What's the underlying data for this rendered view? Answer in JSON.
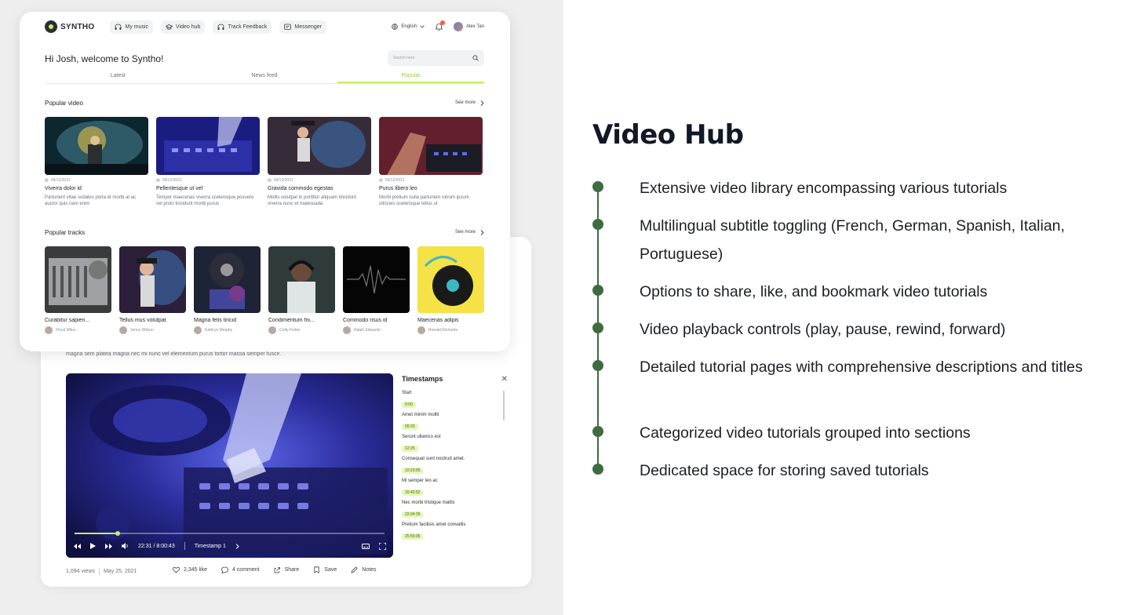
{
  "app": {
    "logo": "SYNTHO",
    "nav": [
      {
        "label": "My music",
        "icon": "headphones-icon"
      },
      {
        "label": "Video hub",
        "icon": "graduation-cap-icon"
      },
      {
        "label": "Track Feedback",
        "icon": "headphones-icon"
      },
      {
        "label": "Messenger",
        "icon": "message-icon"
      }
    ],
    "language": "English",
    "user_name": "Alex Tan",
    "welcome": "Hi Josh, welcome to Syntho!",
    "search_placeholder": "Search here",
    "tabs": [
      "Latest",
      "News feed",
      "Popular"
    ],
    "active_tab": "Popular",
    "popular_video": {
      "title": "Popular video",
      "see_more": "See more",
      "items": [
        {
          "date": "09/12/2021",
          "title": "Viverra dolor id",
          "desc": "Parturient vitae sodales porta et morbi at ac auctor quis nam enim"
        },
        {
          "date": "09/12/2021",
          "title": "Pellentesque ut vel",
          "desc": "Tempor maecenas viverra scelerisque posuere vel proin tincidunt morbi purus"
        },
        {
          "date": "09/12/2021",
          "title": "Gravida commodo egestas",
          "desc": "Mollis volutpat in porttitor aliquam tincidunt viverra nunc et malesuada"
        },
        {
          "date": "09/12/2021",
          "title": "Purus libero leo",
          "desc": "Morbi pretium nulla parturient rutrum ipsum ultricies scelerisque tellus ut"
        }
      ]
    },
    "popular_tracks": {
      "title": "Popular tracks",
      "see_more": "See more",
      "items": [
        {
          "title": "Curabitur sapien...",
          "artist": "Floyd Miles"
        },
        {
          "title": "Tellus mus volutpat",
          "artist": "Jenny Wilson"
        },
        {
          "title": "Magna felis tincid",
          "artist": "Kathryn Murphy"
        },
        {
          "title": "Condimentum frii...",
          "artist": "Cody Fisher"
        },
        {
          "title": "Commodo risus id",
          "artist": "Ralph Edwards"
        },
        {
          "title": "Maecenas adipis",
          "artist": "Ronald Richards"
        }
      ]
    }
  },
  "player": {
    "description": "magna sem platea magna nec mi nunc vel elementum purus tortor massa semper fusce.",
    "time": "22:31 / 8:00:43",
    "timestamp_label": "Timestamp 1",
    "progress": 0.14,
    "timestamps_title": "Timestamps",
    "timestamps": [
      {
        "label": "Start",
        "time": "0:00"
      },
      {
        "label": "Amet minim mollit",
        "time": "09:20"
      },
      {
        "label": "Serunt ullamco est",
        "time": "12:25"
      },
      {
        "label": "Consequat sunt nostrud amet.",
        "time": "10:23:05"
      },
      {
        "label": "Mi semper leo ac",
        "time": "15:43:52"
      },
      {
        "label": "Nec morbi tristique mattis",
        "time": "22:04:35"
      },
      {
        "label": "Pretium facilisis amet convallis",
        "time": "25:55:05"
      }
    ],
    "views": "1,094 views",
    "date": "May 25, 2021",
    "actions": [
      {
        "label": "2,345 like",
        "icon": "heart-icon"
      },
      {
        "label": "4 comment",
        "icon": "comment-icon"
      },
      {
        "label": "Share",
        "icon": "share-icon"
      },
      {
        "label": "Save",
        "icon": "bookmark-icon"
      },
      {
        "label": "Notes",
        "icon": "pencil-icon"
      }
    ]
  },
  "feature_panel": {
    "title": "Video Hub",
    "features": [
      "Extensive video library encompassing various tutorials",
      "Multilingual subtitle toggling (French, German, Spanish, Italian, Portuguese)",
      "Options to share, like, and bookmark video tutorials",
      "Video playback controls (play, pause, rewind, forward)",
      "Detailed tutorial pages with comprehensive descriptions and titles",
      "Categorized video tutorials grouped into sections",
      "Dedicated space for storing saved tutorials"
    ],
    "accent_color": "#3e6b40"
  },
  "colors": {
    "accent_lime": "#c8f060",
    "notification": "#ff5a36",
    "left_bg": "#eeeeef"
  }
}
